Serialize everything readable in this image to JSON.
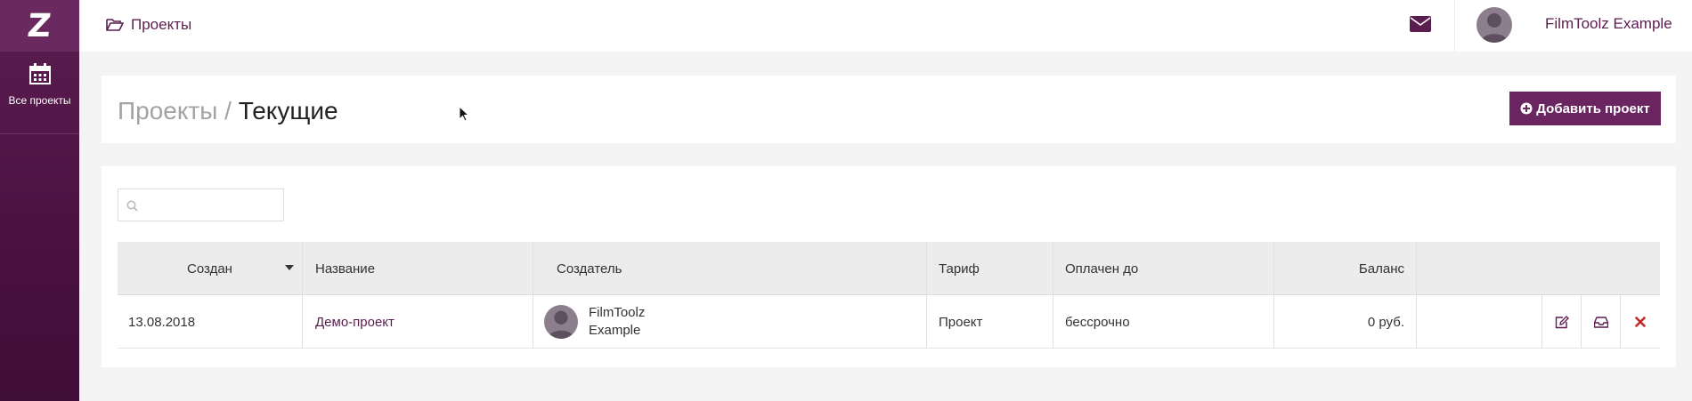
{
  "sidebar": {
    "logo": "Z",
    "items": [
      {
        "label": "Все проекты",
        "icon": "calendar-icon"
      }
    ]
  },
  "topbar": {
    "section": "Проекты",
    "section_icon": "folder-open-icon",
    "mail_icon": "envelope-icon",
    "user_name": "FilmToolz Example"
  },
  "page": {
    "title_parent": "Проекты",
    "title_sep": "/",
    "title_current": "Текущие",
    "add_button": "Добавить проект"
  },
  "table": {
    "search_placeholder": "",
    "columns": [
      "Создан",
      "Название",
      "Создатель",
      "Тариф",
      "Оплачен до",
      "Баланс"
    ],
    "rows": [
      {
        "created": "13.08.2018",
        "name": "Демо-проект",
        "creator_line1": "FilmToolz",
        "creator_line2": "Example",
        "tariff": "Проект",
        "paid_until": "бессрочно",
        "balance": "0 руб."
      }
    ]
  },
  "colors": {
    "brand": "#5b1d50",
    "button": "#6a2460",
    "delete": "#c62828"
  }
}
